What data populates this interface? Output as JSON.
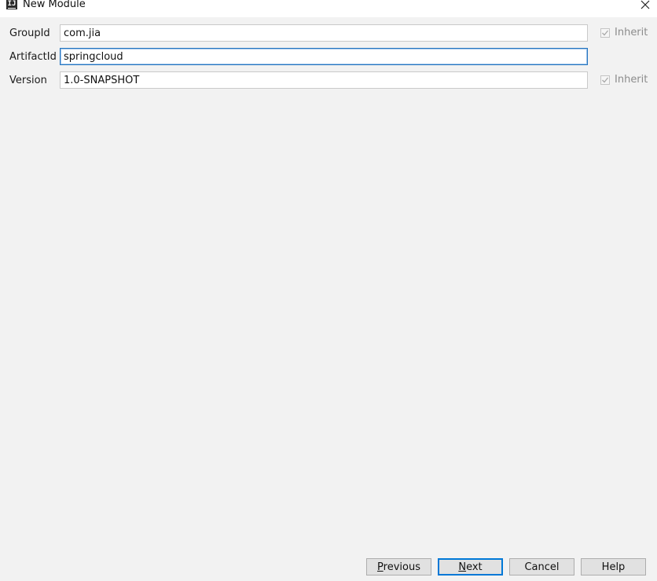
{
  "window": {
    "title": "New Module",
    "app_icon_text": "IJ"
  },
  "form": {
    "group_id": {
      "label": "GroupId",
      "value": "com.jia",
      "inherit_label": "Inherit",
      "inherit_checked": true
    },
    "artifact_id": {
      "label": "ArtifactId",
      "value": "springcloud"
    },
    "version": {
      "label": "Version",
      "value": "1.0-SNAPSHOT",
      "inherit_label": "Inherit",
      "inherit_checked": true
    }
  },
  "buttons": {
    "previous": {
      "mnemonic": "P",
      "rest": "revious"
    },
    "next": {
      "mnemonic": "N",
      "rest": "ext"
    },
    "cancel": "Cancel",
    "help": "Help"
  },
  "colors": {
    "background": "#f2f2f2",
    "focus_border": "#2675bf",
    "default_button_border": "#0078d7",
    "disabled_text": "#8c8c8c"
  }
}
